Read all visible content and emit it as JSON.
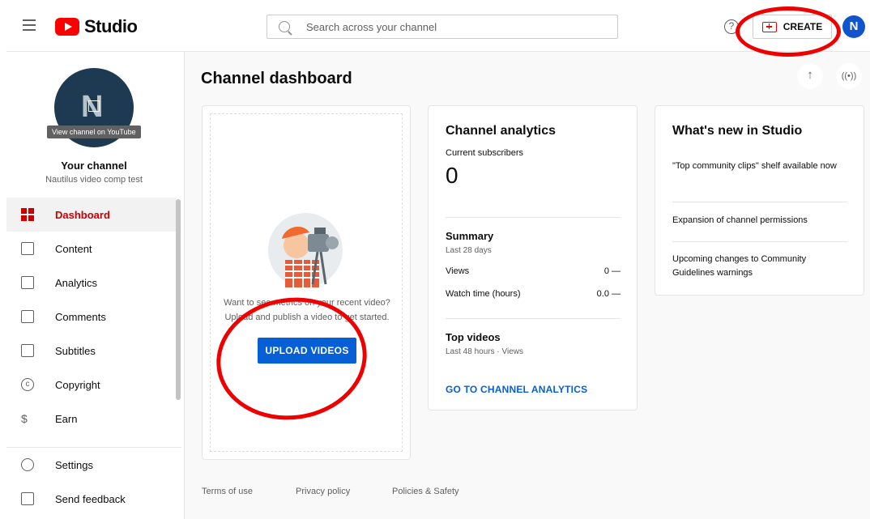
{
  "header": {
    "logo_text": "Studio",
    "search_placeholder": "Search across your channel",
    "help_glyph": "?",
    "create_label": "CREATE",
    "avatar_letter": "N"
  },
  "sidebar": {
    "avatar_letter": "N",
    "tooltip": "View channel on YouTube",
    "channel_title": "Your channel",
    "channel_name": "Nautilus video comp test",
    "items": [
      {
        "label": "Dashboard"
      },
      {
        "label": "Content"
      },
      {
        "label": "Analytics"
      },
      {
        "label": "Comments"
      },
      {
        "label": "Subtitles"
      },
      {
        "label": "Copyright"
      },
      {
        "label": "Earn"
      }
    ],
    "bottom_items": [
      {
        "label": "Settings"
      },
      {
        "label": "Send feedback"
      }
    ]
  },
  "main": {
    "title": "Channel dashboard",
    "upload_card": {
      "text_line1": "Want to see metrics on your recent video?",
      "text_line2": "Upload and publish a video to get started.",
      "button_label": "UPLOAD VIDEOS"
    },
    "analytics_card": {
      "title": "Channel analytics",
      "subscribers_label": "Current subscribers",
      "subscribers_count": "0",
      "summary_title": "Summary",
      "summary_sub": "Last 28 days",
      "views_label": "Views",
      "views_value": "0 —",
      "watch_label": "Watch time (hours)",
      "watch_value": "0.0 —",
      "top_title": "Top videos",
      "top_sub": "Last 48 hours · Views",
      "link_label": "GO TO CHANNEL ANALYTICS"
    },
    "news_card": {
      "title": "What's new in Studio",
      "items": [
        "\"Top community clips\" shelf available now",
        "Expansion of channel permissions",
        "Upcoming changes to Community Guidelines warnings"
      ]
    },
    "footer": {
      "terms": "Terms of use",
      "privacy": "Privacy policy",
      "policies": "Policies & Safety"
    }
  },
  "colors": {
    "accent_red": "#cc0000",
    "primary_blue": "#065fd4",
    "annotation_red": "#ee0000"
  }
}
